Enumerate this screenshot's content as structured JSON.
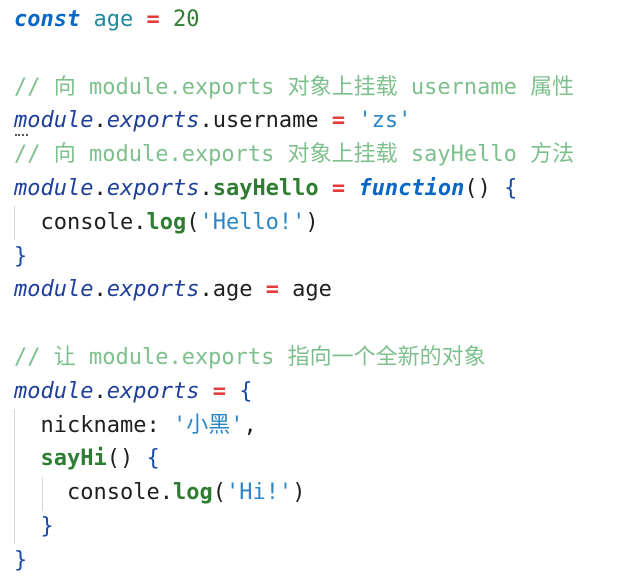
{
  "lines": [
    [
      "const",
      " ",
      "age",
      " ",
      "=",
      " ",
      "20"
    ],
    [
      ""
    ],
    [
      "// 向 module.exports 对象上挂载 username 属性"
    ],
    [
      "module",
      ".",
      "exports",
      ".username ",
      "=",
      " ",
      "'zs'"
    ],
    [
      "// 向 module.exports 对象上挂载 sayHello 方法"
    ],
    [
      "module",
      ".",
      "exports",
      ".",
      "sayHello",
      " ",
      "=",
      " ",
      "function",
      "() ",
      "{"
    ],
    [
      "  console.",
      "log",
      "(",
      "'Hello!'",
      ")"
    ],
    [
      "}"
    ],
    [
      "module",
      ".",
      "exports",
      ".age ",
      "=",
      " age"
    ],
    [
      ""
    ],
    [
      "// 让 module.exports 指向一个全新的对象"
    ],
    [
      "module",
      ".",
      "exports",
      " ",
      "=",
      " ",
      "{"
    ],
    [
      "  nickname: ",
      "'小黑'",
      ","
    ],
    [
      "  ",
      "sayHi",
      "() ",
      "{"
    ],
    [
      "    console.",
      "log",
      "(",
      "'Hi!'",
      ")"
    ],
    [
      "  }"
    ],
    [
      "}"
    ]
  ]
}
